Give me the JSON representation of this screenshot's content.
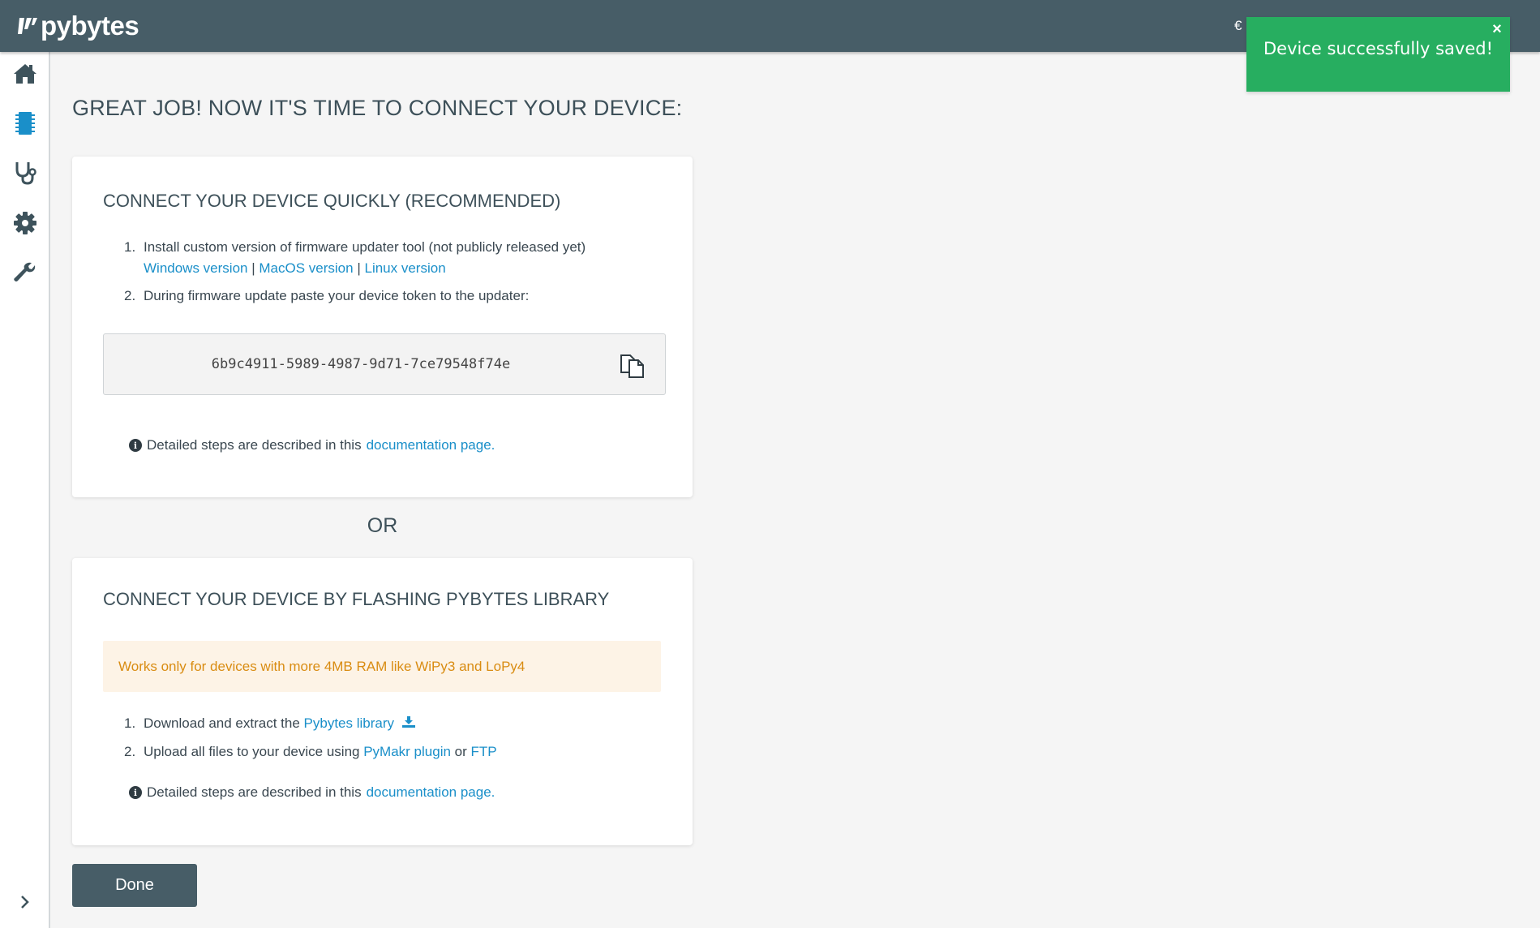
{
  "header": {
    "logo_text": "pybytes",
    "partial_glyph": "€"
  },
  "sidebar": {
    "items": [
      {
        "icon": "home-icon"
      },
      {
        "icon": "device-chip-icon",
        "active": true
      },
      {
        "icon": "stethoscope-icon"
      },
      {
        "icon": "gear-icon"
      },
      {
        "icon": "wrench-icon"
      }
    ],
    "expand_icon": "chevron-right-icon"
  },
  "toast": {
    "message": "Device successfully saved!",
    "close": "×",
    "color": "#27ae60"
  },
  "page": {
    "title": "GREAT JOB! NOW IT'S TIME TO CONNECT YOUR DEVICE:",
    "or_label": "OR",
    "done_label": "Done"
  },
  "quick_card": {
    "title": "CONNECT YOUR DEVICE QUICKLY (RECOMMENDED)",
    "step1_num": "1.",
    "step1_text": "Install custom version of firmware updater tool (not publicly released yet)",
    "windows_link": "Windows version",
    "macos_link": "MacOS version",
    "linux_link": "Linux version",
    "separator": "|",
    "step2_num": "2.",
    "step2_text": "During firmware update paste your device token to the updater:",
    "token": "6b9c4911-5989-4987-9d71-7ce79548f74e",
    "info_text": "Detailed steps are described in this",
    "info_link": "documentation page."
  },
  "flash_card": {
    "title": "CONNECT YOUR DEVICE BY FLASHING PYBYTES LIBRARY",
    "warning": "Works only for devices with more 4MB RAM like WiPy3 and LoPy4",
    "step1_num": "1.",
    "step1_text": "Download and extract the",
    "step1_link": "Pybytes library",
    "step2_num": "2.",
    "step2_text": "Upload all files to your device using",
    "pymakr_link": "PyMakr plugin",
    "or_word": "or",
    "ftp_link": "FTP",
    "info_text": "Detailed steps are described in this",
    "info_link": "documentation page."
  },
  "colors": {
    "header_bg": "#475d67",
    "accent_blue": "#1a8fc9",
    "warning_bg": "#fdf3e6",
    "warning_text": "#d98c12",
    "success_green": "#27ae60"
  }
}
